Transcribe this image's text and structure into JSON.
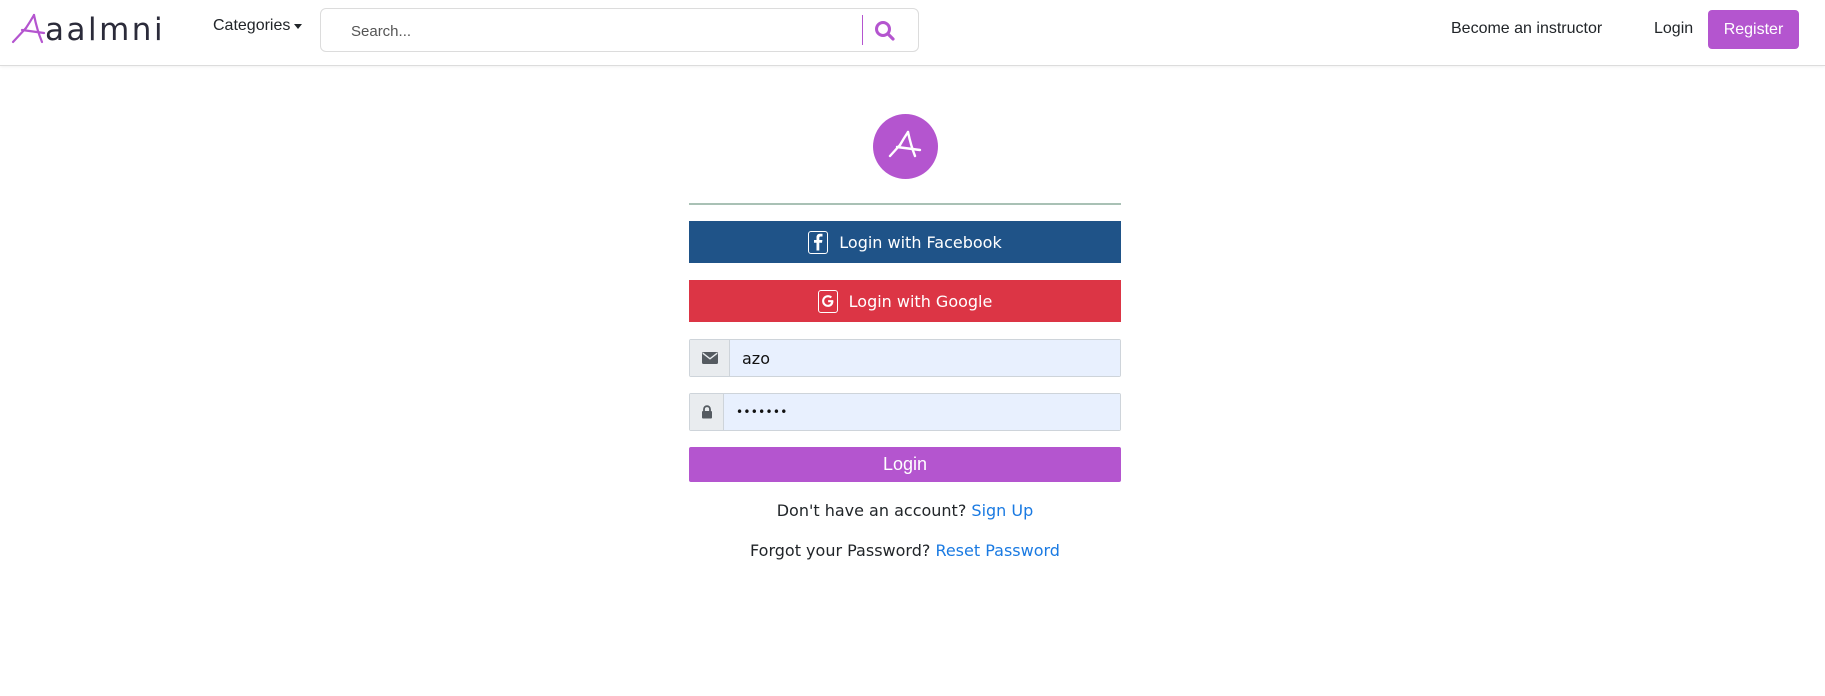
{
  "nav": {
    "brand_text": "aalmni",
    "categories_label": "Categories",
    "search_placeholder": "Search...",
    "become_instructor": "Become an instructor",
    "login": "Login",
    "register": "Register"
  },
  "login_form": {
    "facebook_label": "Login with Facebook",
    "google_label": "Login with Google",
    "email_value": "azo",
    "password_value": "•••••••",
    "submit_label": "Login",
    "signup_prompt": "Don't have an account?",
    "signup_link": "Sign Up",
    "forgot_prompt": "Forgot your Password?",
    "reset_link": "Reset Password"
  },
  "icons": {
    "brand": "brand-logo-icon",
    "search": "search-icon",
    "facebook": "facebook-icon",
    "google": "google-icon",
    "email": "envelope-icon",
    "password": "lock-icon"
  },
  "colors": {
    "accent": "#b455cf",
    "facebook": "#1f5388",
    "google": "#dc3545",
    "link": "#1a7ae2",
    "autofill": "#e8f0fe"
  }
}
